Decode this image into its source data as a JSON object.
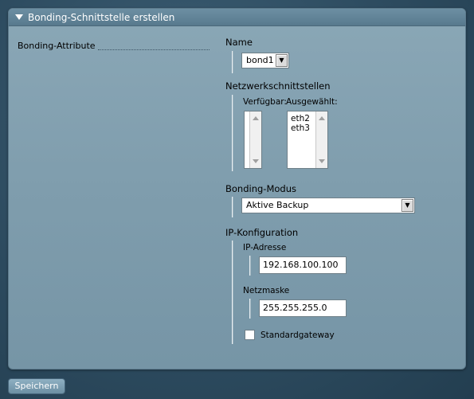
{
  "panel": {
    "title": "Bonding-Schnittstelle erstellen"
  },
  "left": {
    "label": "Bonding-Attribute"
  },
  "name_section": {
    "title": "Name",
    "selected": "bond1"
  },
  "nics_section": {
    "title": "Netzwerkschnittstellen",
    "available_label": "Verfügbar:",
    "selected_label": "Ausgewählt:",
    "selected_items": [
      "eth2",
      "eth3"
    ]
  },
  "mode_section": {
    "title": "Bonding-Modus",
    "selected": "Aktive Backup"
  },
  "ip_section": {
    "title": "IP-Konfiguration",
    "ip_label": "IP-Adresse",
    "ip_value": "192.168.100.100",
    "mask_label": "Netzmaske",
    "mask_value": "255.255.255.0",
    "gateway_label": "Standardgateway",
    "gateway_checked": false
  },
  "buttons": {
    "save": "Speichern"
  }
}
